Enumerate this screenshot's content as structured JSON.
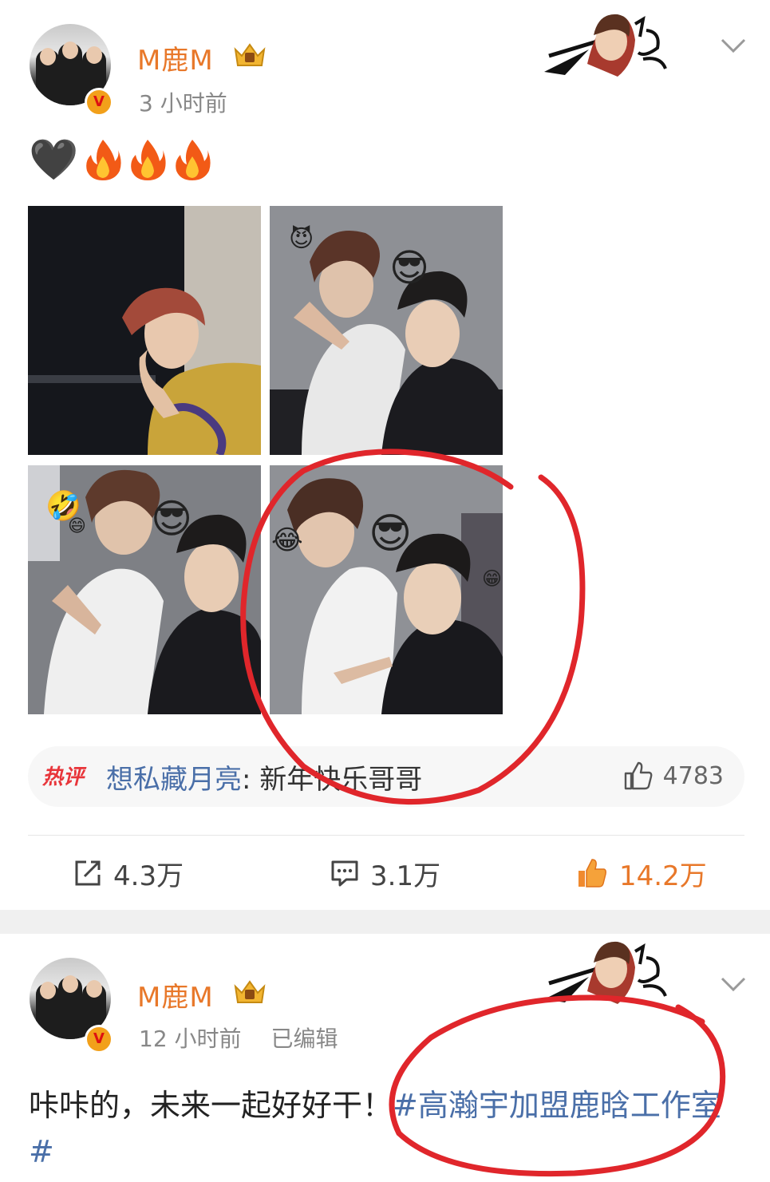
{
  "post1": {
    "username": "M鹿M",
    "time": "3 小时前",
    "content_emojis": [
      "🖤",
      "flame",
      "flame",
      "flame"
    ],
    "photos": [
      {
        "emoji_overlays": []
      },
      {
        "emoji_overlays": [
          "😈",
          "😎"
        ]
      },
      {
        "emoji_overlays": [
          "🤣",
          "😄",
          "😎"
        ]
      },
      {
        "emoji_overlays": [
          "😂",
          "😎",
          "😁"
        ]
      }
    ],
    "hot_comment": {
      "tag": "热评",
      "user": "想私藏月亮",
      "separator": ":",
      "text": " 新年快乐哥哥",
      "likes": "4783"
    },
    "actions": {
      "repost": "4.3万",
      "comment": "3.1万",
      "like": "14.2万"
    }
  },
  "post2": {
    "username": "M鹿M",
    "time": "12 小时前",
    "edited": "已编辑",
    "text": "咔咔的，未来一起好好干！",
    "topic": "#高瀚宇加盟鹿晗工作室#"
  },
  "colors": {
    "username": "#e8782a",
    "topic": "#4a6fa8",
    "hot_tag": "#e8353a",
    "annotation": "#e0262b"
  }
}
